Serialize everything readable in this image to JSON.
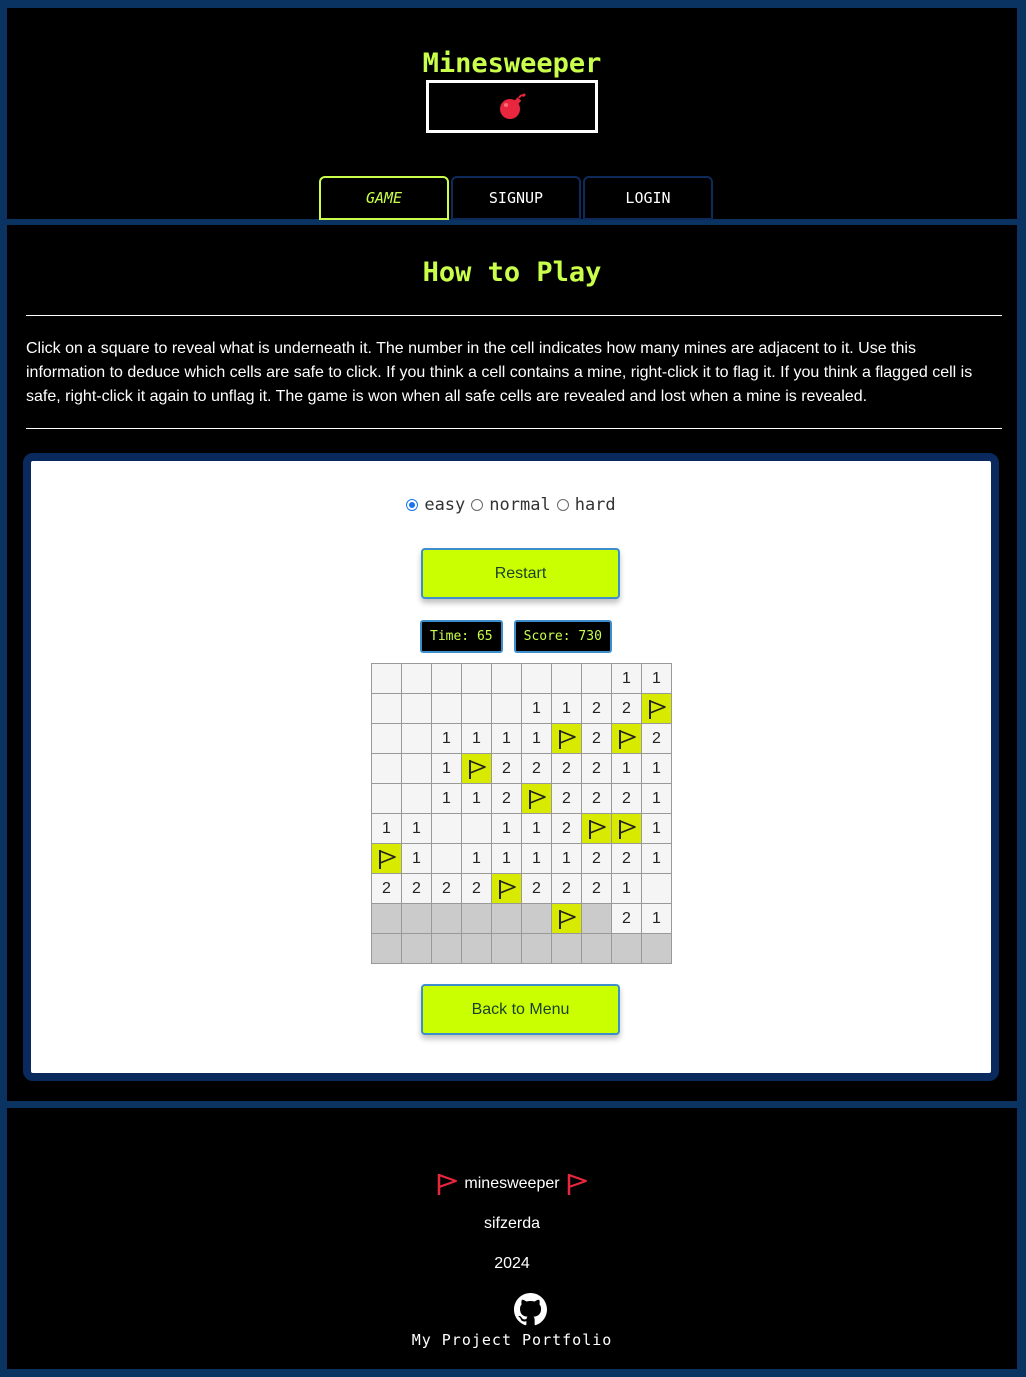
{
  "header": {
    "title": "Minesweeper",
    "logo_icon": "bomb-icon",
    "nav": [
      {
        "label": "GAME",
        "active": true
      },
      {
        "label": "SIGNUP",
        "active": false
      },
      {
        "label": "LOGIN",
        "active": false
      }
    ]
  },
  "main": {
    "heading": "How to Play",
    "instructions": "Click on a square to reveal what is underneath it. The number in the cell indicates how many mines are adjacent to it. Use this information to deduce which cells are safe to click. If you think a cell contains a mine, right-click it to flag it. If you think a flagged cell is safe, right-click it again to unflag it. The game is won when all safe cells are revealed and lost when a mine is revealed."
  },
  "game": {
    "difficulty": {
      "options": [
        "easy",
        "normal",
        "hard"
      ],
      "selected": "easy"
    },
    "restart_label": "Restart",
    "time_label": "Time: 65",
    "score_label": "Score: 730",
    "board": [
      [
        ".",
        ".",
        ".",
        ".",
        ".",
        ".",
        ".",
        ".",
        "1",
        "1"
      ],
      [
        ".",
        ".",
        ".",
        ".",
        ".",
        "1",
        "1",
        "2",
        "2",
        "F"
      ],
      [
        ".",
        ".",
        "1",
        "1",
        "1",
        "1",
        "F",
        "2",
        "F",
        "2"
      ],
      [
        ".",
        ".",
        "1",
        "F",
        "2",
        "2",
        "2",
        "2",
        "1",
        "1"
      ],
      [
        ".",
        ".",
        "1",
        "1",
        "2",
        "F",
        "2",
        "2",
        "2",
        "1"
      ],
      [
        "1",
        "1",
        ".",
        ".",
        "1",
        "1",
        "2",
        "F",
        "F",
        "1"
      ],
      [
        "F",
        "1",
        ".",
        "1",
        "1",
        "1",
        "1",
        "2",
        "2",
        "1"
      ],
      [
        "2",
        "2",
        "2",
        "2",
        "F",
        "2",
        "2",
        "2",
        "1",
        "."
      ],
      [
        "#",
        "#",
        "#",
        "#",
        "#",
        "#",
        "F",
        "#",
        "2",
        "1"
      ],
      [
        "#",
        "#",
        "#",
        "#",
        "#",
        "#",
        "#",
        "#",
        "#",
        "#"
      ]
    ],
    "back_label": "Back to Menu"
  },
  "footer": {
    "name": "minesweeper",
    "flag_icon": "flag-icon",
    "author": "sifzerda",
    "year": "2024",
    "github_icon": "github-icon",
    "portfolio_label": "My Project Portfolio"
  },
  "colors": {
    "accent": "#c9ff4a",
    "button": "#c9ff00",
    "frame": "#0b3361",
    "flag_cell": "#d7ea00",
    "flag_red": "#e8273e"
  }
}
